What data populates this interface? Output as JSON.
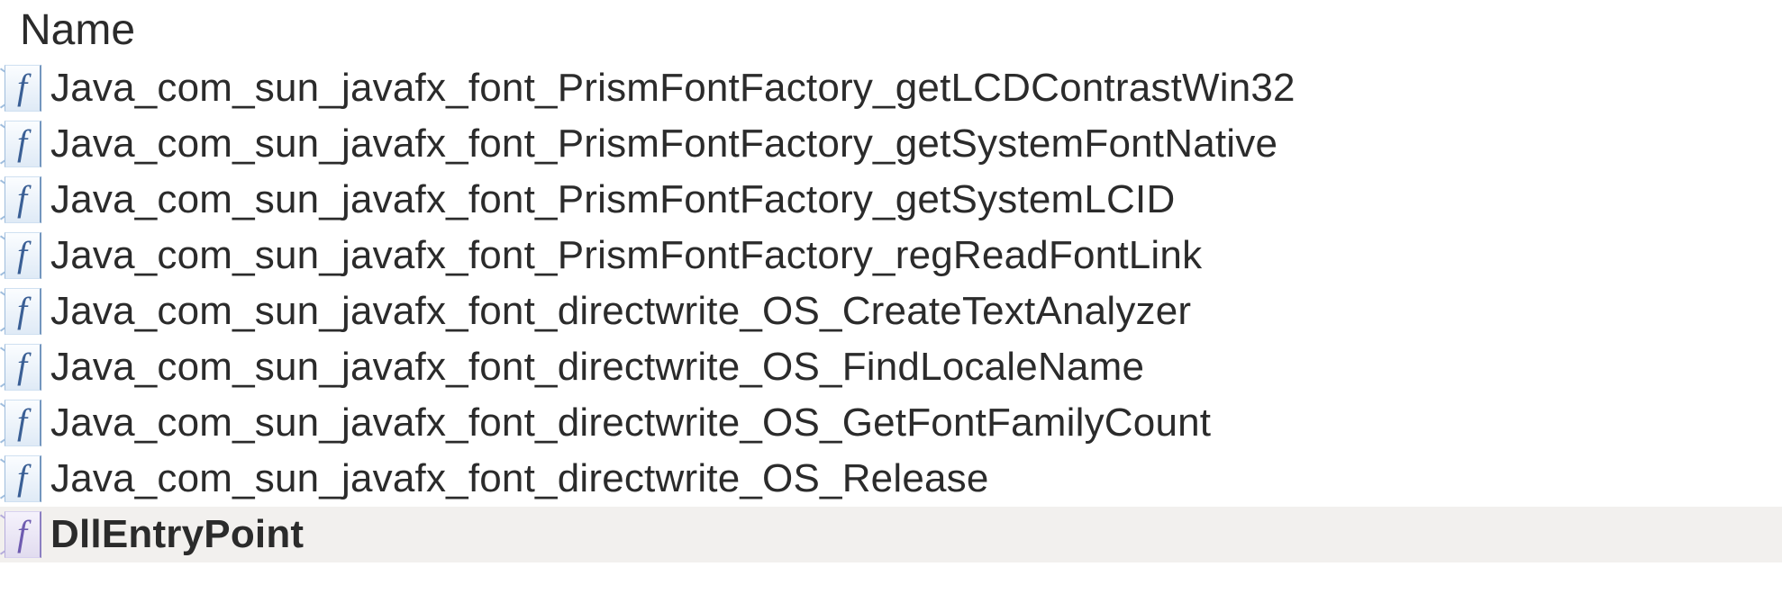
{
  "columns": {
    "name": "Name"
  },
  "rows": [
    {
      "name": "Java_com_sun_javafx_font_PrismFontFactory_getLCDContrastWin32",
      "icon": "function-icon",
      "selected": false
    },
    {
      "name": "Java_com_sun_javafx_font_PrismFontFactory_getSystemFontNative",
      "icon": "function-icon",
      "selected": false
    },
    {
      "name": "Java_com_sun_javafx_font_PrismFontFactory_getSystemLCID",
      "icon": "function-icon",
      "selected": false
    },
    {
      "name": "Java_com_sun_javafx_font_PrismFontFactory_regReadFontLink",
      "icon": "function-icon",
      "selected": false
    },
    {
      "name": "Java_com_sun_javafx_font_directwrite_OS_CreateTextAnalyzer",
      "icon": "function-icon",
      "selected": false
    },
    {
      "name": "Java_com_sun_javafx_font_directwrite_OS_FindLocaleName",
      "icon": "function-icon",
      "selected": false
    },
    {
      "name": "Java_com_sun_javafx_font_directwrite_OS_GetFontFamilyCount",
      "icon": "function-icon",
      "selected": false
    },
    {
      "name": "Java_com_sun_javafx_font_directwrite_OS_Release",
      "icon": "function-icon",
      "selected": false
    },
    {
      "name": "DllEntryPoint",
      "icon": "library-function-icon",
      "selected": true
    }
  ]
}
